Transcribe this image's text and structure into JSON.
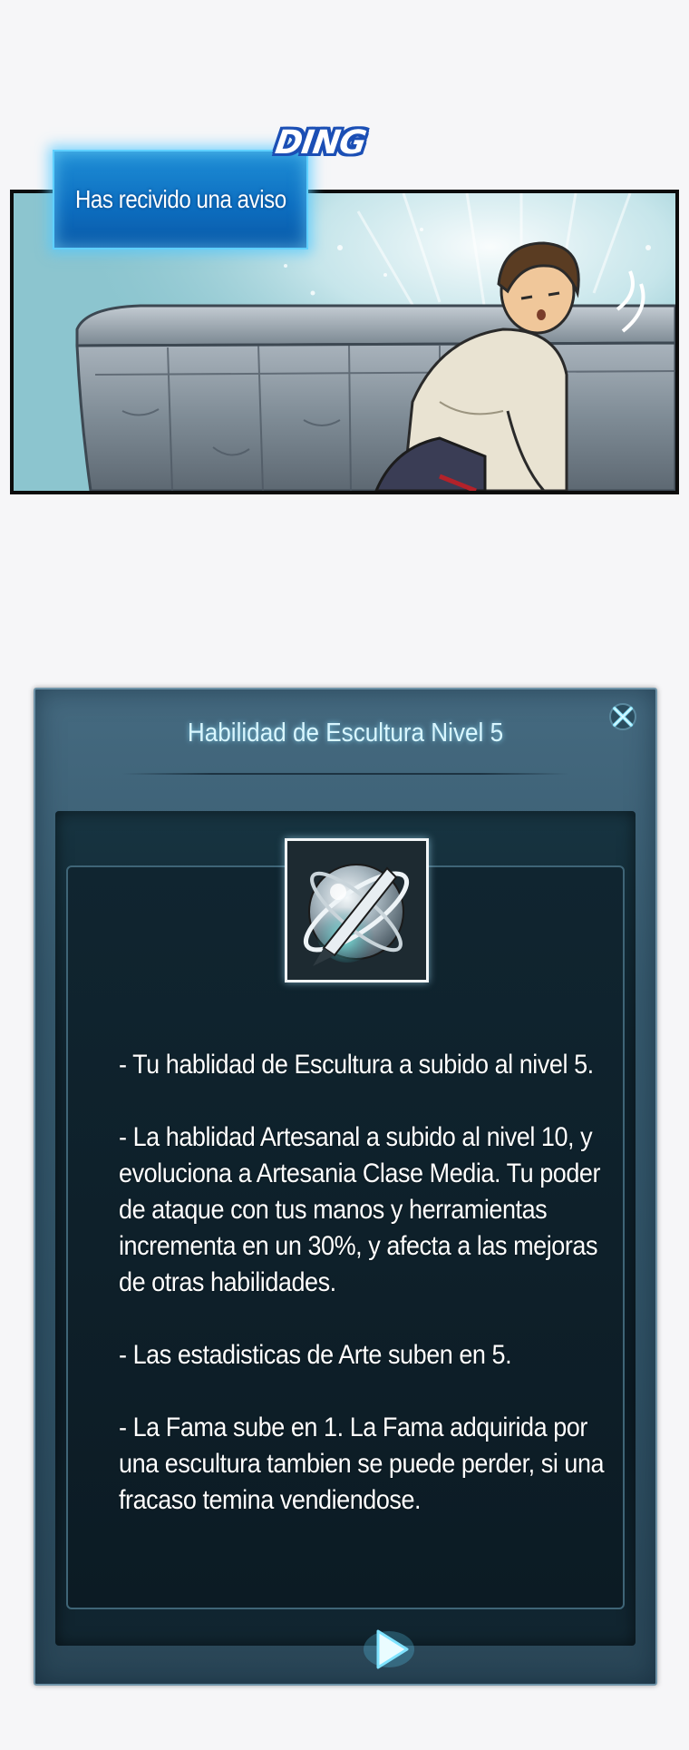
{
  "comic": {
    "sound_effect": "DING",
    "notice": {
      "text": "Has recivido una aviso"
    }
  },
  "window": {
    "title": "Habilidad de Escultura Nivel 5",
    "close_icon": "close-x-icon",
    "skill_icon": "sculpture-orb-icon",
    "paragraphs": [
      "- Tu hablidad de Escultura a subido al nivel 5.",
      "- La hablidad Artesanal a subido al nivel 10, y evoluciona a Artesania Clase Media. Tu poder de ataque con tus manos y herramientas incrementa en un 30%, y afecta a las mejoras de otras habilidades.",
      "- Las estadisticas de Arte suben en 5.",
      "- La Fama sube en 1. La Fama adquirida por una escultura tambien se puede perder, si una fracaso temina vendiendose."
    ],
    "next_icon": "play-next-icon"
  },
  "colors": {
    "page_background": "#f6f6f8",
    "notice_blue": "#0d6fc1",
    "window_frame": "#375a6e",
    "window_inner": "#0d1d27",
    "title_text": "#d8f6ff",
    "body_text": "#ffffff"
  }
}
